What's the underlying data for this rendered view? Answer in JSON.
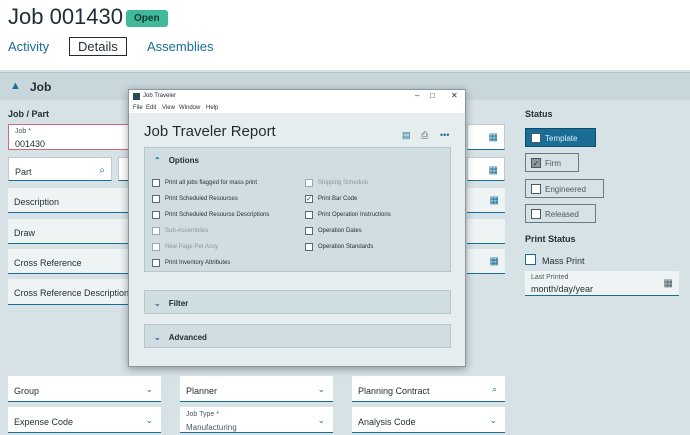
{
  "header": {
    "job_title": "Job 001430",
    "status_badge": "Open"
  },
  "tabs": {
    "activity": "Activity",
    "details": "Details",
    "assemblies": "Assemblies"
  },
  "section": {
    "label": "Job"
  },
  "left": {
    "group_label": "Job / Part",
    "job": {
      "label": "Job *",
      "value": "001430"
    },
    "part": "Part",
    "description": "Description",
    "draw": "Draw",
    "cross_reference": "Cross Reference",
    "cross_reference_description": "Cross Reference Description"
  },
  "status": {
    "title": "Status",
    "template": "Template",
    "firm": "Firm",
    "engineered": "Engineered",
    "released": "Released",
    "print_status_title": "Print Status",
    "mass_print": "Mass Print",
    "last_printed_label": "Last Printed",
    "last_printed_value": "month/day/year"
  },
  "bottom": {
    "group": "Group",
    "planner": "Planner",
    "planning_contract": "Planning Contract",
    "expense_code": "Expense Code",
    "job_type_label": "Job Type *",
    "job_type_value": "Manufacturing",
    "analysis_code": "Analysis Code"
  },
  "modal": {
    "window_title": "Job Traveler",
    "menu": [
      "File",
      "Edit",
      "View",
      "Window",
      "Help"
    ],
    "title": "Job Traveler Report",
    "options_header": "Options",
    "options_left": [
      "Print all jobs flagged for mass print",
      "Print Scheduled Resources",
      "Print Scheduled Resource Descriptions",
      "Sub-Assemblies",
      "New Page Per Assy",
      "Print Inventory Attributes"
    ],
    "options_right": [
      "Shipping Schedule",
      "Print Bar Code",
      "Print Operation Instructions",
      "Operation Dates",
      "Operation Standards"
    ],
    "filter_header": "Filter",
    "advanced_header": "Advanced"
  }
}
